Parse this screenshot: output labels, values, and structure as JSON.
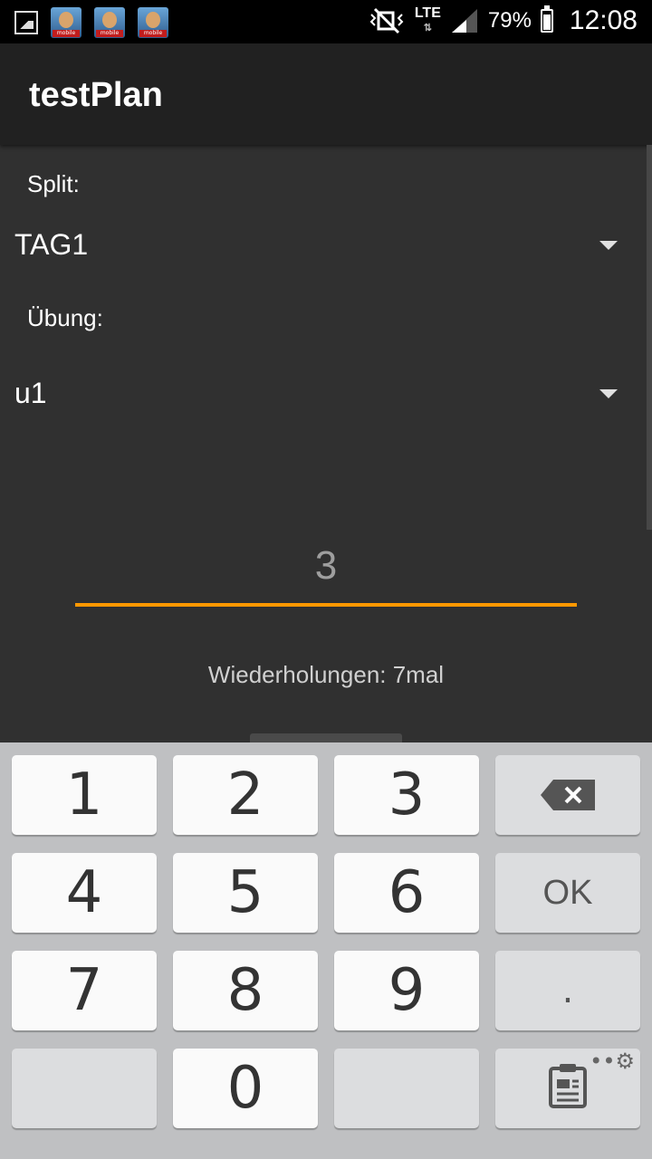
{
  "status_bar": {
    "app_tag": "mobile",
    "network": "LTE",
    "battery_percent": "79%",
    "battery_level": 0.79,
    "time": "12:08"
  },
  "app_bar": {
    "title": "testPlan"
  },
  "form": {
    "split_label": "Split:",
    "split_value": "TAG1",
    "exercise_label": "Übung:",
    "exercise_value": "u1",
    "number_value": "3",
    "repetitions_text": "Wiederholungen: 7mal"
  },
  "keyboard": {
    "keys": [
      "1",
      "2",
      "3",
      "4",
      "5",
      "6",
      "7",
      "8",
      "9",
      "0"
    ],
    "ok_label": "OK",
    "dot_label": "."
  },
  "colors": {
    "accent": "#ff9800",
    "background": "#303030",
    "app_bar": "#212121",
    "keyboard": "#bfc0c2"
  }
}
